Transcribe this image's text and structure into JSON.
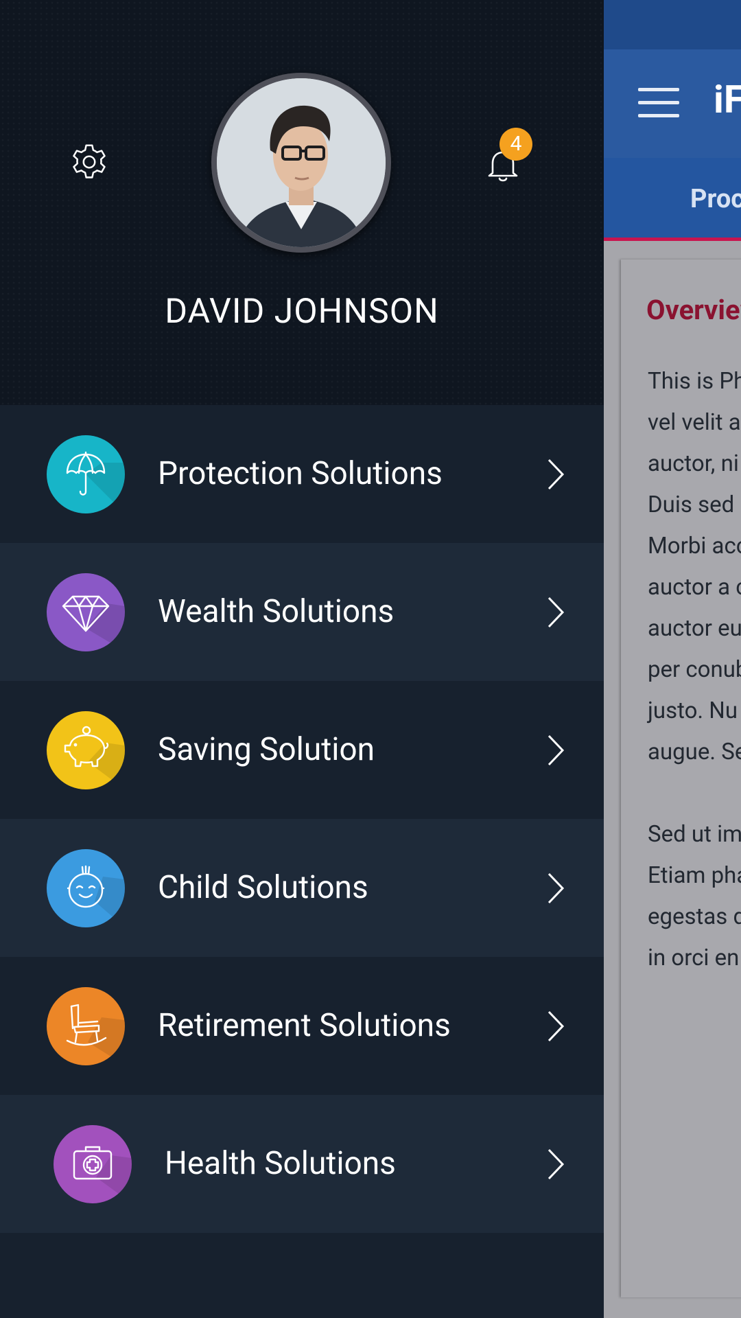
{
  "user": {
    "name": "DAVID JOHNSON",
    "notification_count": "4"
  },
  "menu": {
    "items": [
      {
        "label": "Protection Solutions",
        "icon": "umbrella-icon",
        "color": "#17b5c8"
      },
      {
        "label": "Wealth Solutions",
        "icon": "diamond-icon",
        "color": "#8a58c6"
      },
      {
        "label": "Saving Solution",
        "icon": "piggy-bank-icon",
        "color": "#f2c318"
      },
      {
        "label": "Child Solutions",
        "icon": "baby-face-icon",
        "color": "#3b9be0"
      },
      {
        "label": "Retirement Solutions",
        "icon": "rocking-chair-icon",
        "color": "#ec8627"
      },
      {
        "label": "Health Solutions",
        "icon": "first-aid-kit-icon",
        "color": "#a251bd"
      }
    ]
  },
  "background_app": {
    "title": "iF",
    "tab": "Proc",
    "section_title": "Overview",
    "paragraph1": [
      "This is Ph",
      "vel velit a",
      "auctor, ni",
      "Duis sed",
      "Morbi acc",
      "auctor a c",
      "auctor eu",
      "per conub",
      "justo. Nu",
      "augue. Se"
    ],
    "paragraph2": [
      "Sed ut im",
      "Etiam pha",
      "egestas d",
      "in orci en"
    ]
  },
  "colors": {
    "drawer_bg": "#17212e",
    "drawer_alt_row": "#1e2a39",
    "toolbar": "#2b5aa0",
    "accent": "#c8154f",
    "badge": "#f5a11f"
  }
}
